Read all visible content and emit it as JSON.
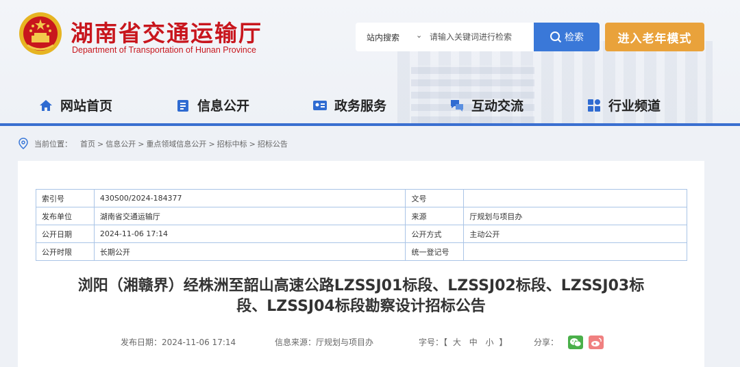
{
  "header": {
    "title": "湖南省交通运输厅",
    "subtitle": "Department of Transportation of Hunan Province",
    "search_scope": "站内搜索",
    "search_placeholder": "请输入关键词进行检索",
    "search_button": "检索",
    "elder_mode_button": "进入老年模式",
    "brand_color": "#c8161d",
    "accent_color": "#3a78d8",
    "elder_color": "#e9a23b"
  },
  "nav": {
    "items": [
      {
        "label": "网站首页",
        "icon": "home-icon"
      },
      {
        "label": "信息公开",
        "icon": "info-doc-icon"
      },
      {
        "label": "政务服务",
        "icon": "service-card-icon"
      },
      {
        "label": "互动交流",
        "icon": "chat-icon"
      },
      {
        "label": "行业频道",
        "icon": "grid-icon"
      }
    ]
  },
  "breadcrumb": {
    "prefix": "当前位置：",
    "items": [
      "首页",
      "信息公开",
      "重点领域信息公开",
      "招标中标",
      "招标公告"
    ],
    "separator": ">"
  },
  "meta_table": {
    "rows": [
      {
        "k1": "索引号",
        "v1": "430S00/2024-184377",
        "k2": "文号",
        "v2": ""
      },
      {
        "k1": "发布单位",
        "v1": "湖南省交通运输厅",
        "k2": "来源",
        "v2": "厅规划与项目办"
      },
      {
        "k1": "公开日期",
        "v1": "2024-11-06 17:14",
        "k2": "公开方式",
        "v2": "主动公开"
      },
      {
        "k1": "公开时限",
        "v1": "长期公开",
        "k2": "统一登记号",
        "v2": ""
      }
    ]
  },
  "document": {
    "title_line1": "浏阳（湘赣界）经株洲至韶山高速公路LZSSJ01标段、LZSSJ02标段、LZSSJ03标",
    "title_line2": "段、LZSSJ04标段勘察设计招标公告",
    "publish_date": "发布日期：2024-11-06 17:14",
    "source": "信息来源：厅规划与项目办",
    "font_size_label": "字号：【",
    "font_large": "大",
    "font_medium": "中",
    "font_small": "小",
    "font_size_end": "】",
    "share_label": "分享：",
    "share_icons": [
      "wechat-icon",
      "weibo-icon"
    ]
  }
}
